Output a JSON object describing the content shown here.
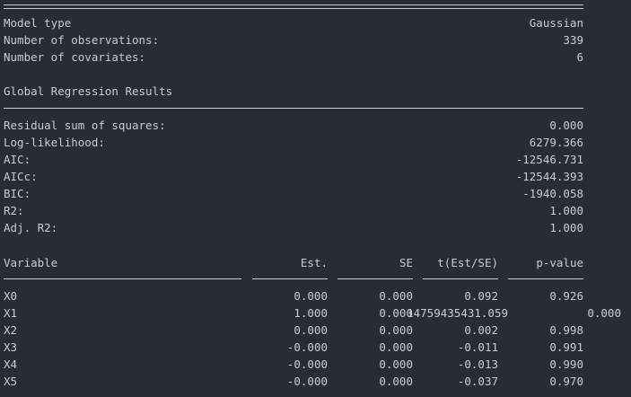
{
  "model_info": [
    {
      "label": "Model type",
      "value": "Gaussian"
    },
    {
      "label": "Number of observations:",
      "value": "339"
    },
    {
      "label": "Number of covariates:",
      "value": "6"
    }
  ],
  "global_section": {
    "title": "Global Regression Results"
  },
  "global_results": [
    {
      "label": "Residual sum of squares:",
      "value": "0.000"
    },
    {
      "label": "Log-likelihood:",
      "value": "6279.366"
    },
    {
      "label": "AIC:",
      "value": "-12546.731"
    },
    {
      "label": "AICc:",
      "value": "-12544.393"
    },
    {
      "label": "BIC:",
      "value": "-1940.058"
    },
    {
      "label": "R2:",
      "value": "1.000"
    },
    {
      "label": "Adj. R2:",
      "value": "1.000"
    }
  ],
  "coef_table": {
    "headers": {
      "variable": "Variable",
      "est": "Est.",
      "se": "SE",
      "t": "t(Est/SE)",
      "p": "p-value"
    },
    "rows": [
      {
        "variable": "X0",
        "est": "0.000",
        "se": "0.000",
        "t": "0.092",
        "p": "0.926"
      },
      {
        "variable": "X1",
        "est": "1.000",
        "se": "0.000",
        "t": "14759435431.059",
        "p": "0.000"
      },
      {
        "variable": "X2",
        "est": "0.000",
        "se": "0.000",
        "t": "0.002",
        "p": "0.998"
      },
      {
        "variable": "X3",
        "est": "-0.000",
        "se": "0.000",
        "t": "-0.011",
        "p": "0.991"
      },
      {
        "variable": "X4",
        "est": "-0.000",
        "se": "0.000",
        "t": "-0.013",
        "p": "0.990"
      },
      {
        "variable": "X5",
        "est": "-0.000",
        "se": "0.000",
        "t": "-0.037",
        "p": "0.970"
      }
    ]
  }
}
